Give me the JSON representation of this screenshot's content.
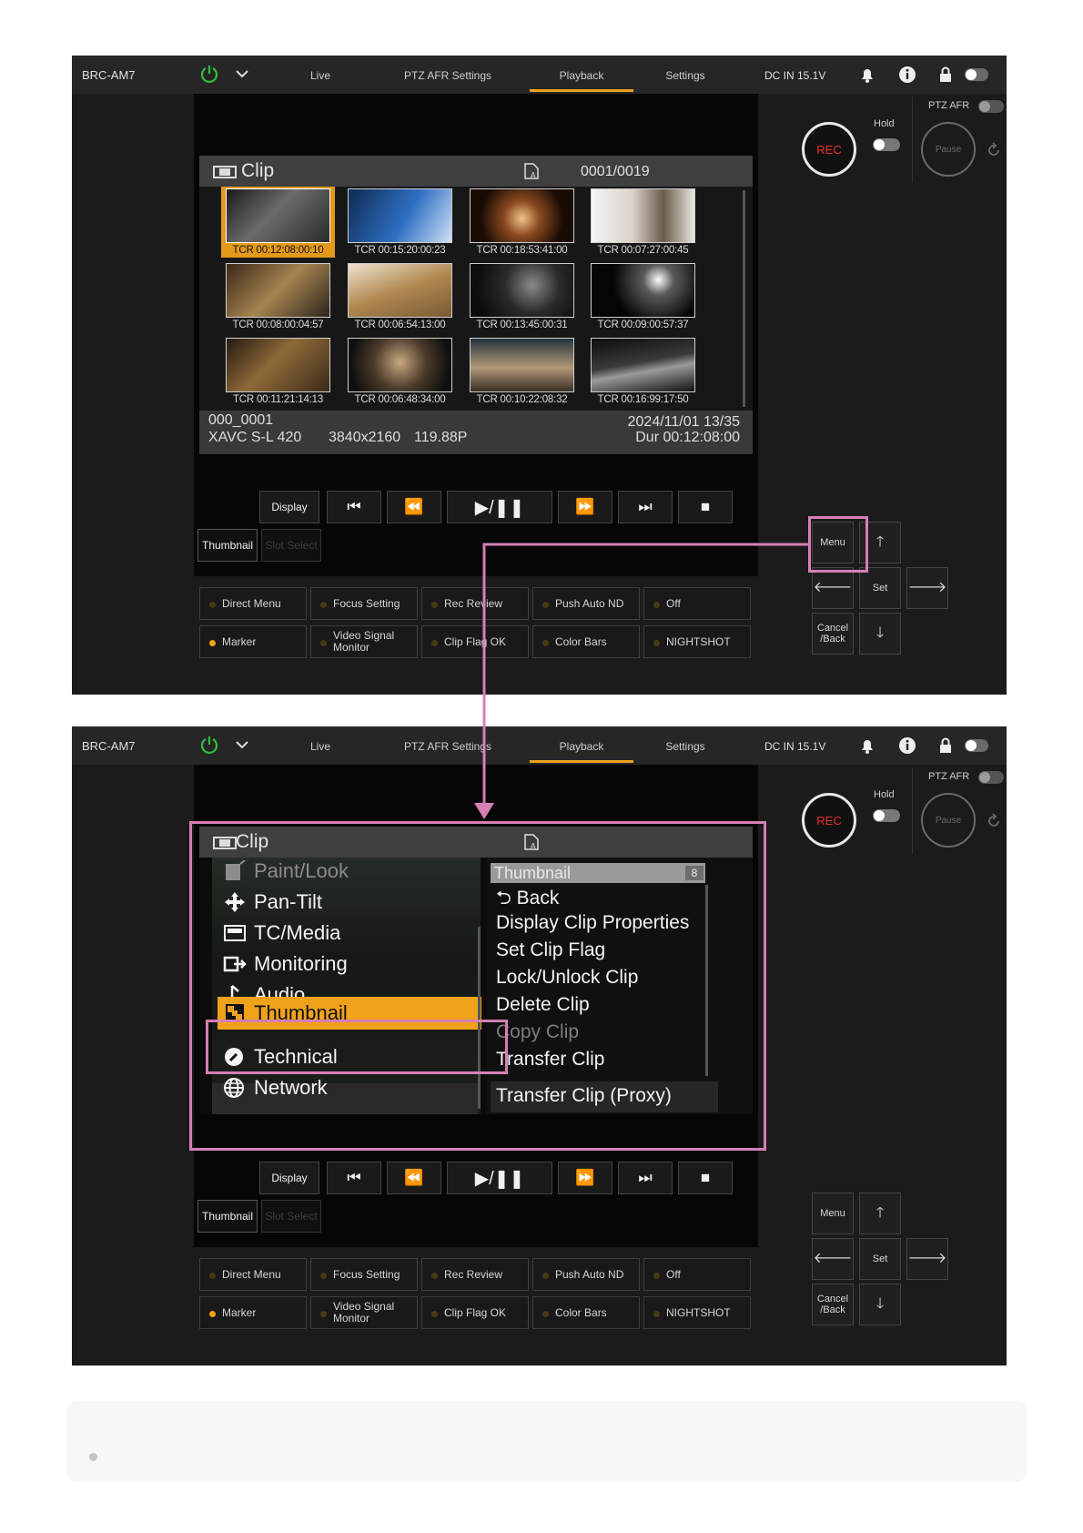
{
  "topbar": {
    "model": "BRC-AM7",
    "tabs": [
      "Live",
      "PTZ AFR Settings",
      "Playback",
      "Settings"
    ],
    "active_tab": "Playback",
    "power_status": "DC IN 15.1V"
  },
  "rec": {
    "label": "REC",
    "hold_label": "Hold",
    "ptz_afr_label": "PTZ AFR",
    "pause_label": "Pause"
  },
  "clip_screen": {
    "title": "Clip",
    "counter": "0001/0019",
    "thumbnails": [
      "TCR 00:12:08:00:10",
      "TCR 00:15:20:00:23",
      "TCR 00:18:53:41:00",
      "TCR 00:07:27:00:45",
      "TCR 00:08:00:04:57",
      "TCR 00:06:54:13:00",
      "TCR 00:13:45:00:31",
      "TCR 00:09:00:57:37",
      "TCR 00:11:21:14:13",
      "TCR 00:06:48:34:00",
      "TCR 00:10:22:08:32",
      "TCR 00:16:99:17:50"
    ],
    "selected_index": 0,
    "info": {
      "clip_name": "000_0001",
      "format": "XAVC S-L 420",
      "resolution": "3840x2160",
      "frame_rate": "119.88P",
      "date": "2024/11/01 13/35",
      "duration": "Dur 00:12:08:00"
    }
  },
  "playback_controls": {
    "display": "Display",
    "thumbnail": "Thumbnail",
    "slot_select": "Slot Select",
    "buttons": [
      "⏮",
      "⏪",
      "▶/❚❚",
      "⏩",
      "⏭",
      "■"
    ]
  },
  "function_buttons": [
    {
      "label": "Direct Menu",
      "on": false
    },
    {
      "label": "Focus Setting",
      "on": false
    },
    {
      "label": "Rec Review",
      "on": false
    },
    {
      "label": "Push Auto ND",
      "on": false
    },
    {
      "label": "Off",
      "on": false
    },
    {
      "label": "Marker",
      "on": true
    },
    {
      "label": "Video Signal Monitor",
      "on": false
    },
    {
      "label": "Clip Flag OK",
      "on": false
    },
    {
      "label": "Color Bars",
      "on": false
    },
    {
      "label": "NIGHTSHOT",
      "on": false
    }
  ],
  "nav": {
    "menu": "Menu",
    "set": "Set",
    "cancel": "Cancel /Back"
  },
  "menu": {
    "title": "Clip",
    "items": [
      {
        "label": "Paint/Look",
        "icon": "paint-look-icon"
      },
      {
        "label": "Pan-Tilt",
        "icon": "pan-tilt-icon"
      },
      {
        "label": "TC/Media",
        "icon": "tc-media-icon"
      },
      {
        "label": "Monitoring",
        "icon": "monitoring-icon"
      },
      {
        "label": "Audio",
        "icon": "audio-icon"
      },
      {
        "label": "Thumbnail",
        "icon": "thumbnail-icon"
      },
      {
        "label": "Technical",
        "icon": "technical-icon"
      },
      {
        "label": "Network",
        "icon": "network-icon"
      }
    ],
    "selected": "Thumbnail",
    "submenu_title": "Thumbnail",
    "submenu_count": "8",
    "submenu": [
      "Back",
      "Display Clip Properties",
      "Set Clip Flag",
      "Lock/Unlock Clip",
      "Delete Clip",
      "Copy Clip",
      "Transfer Clip",
      "Transfer Clip (Proxy)"
    ],
    "submenu_disabled": [
      "Copy Clip"
    ]
  },
  "colors": {
    "accent": "#f0a21a",
    "highlight": "#d67fb4",
    "rec": "#e8302a",
    "power": "#2fbf3a"
  }
}
